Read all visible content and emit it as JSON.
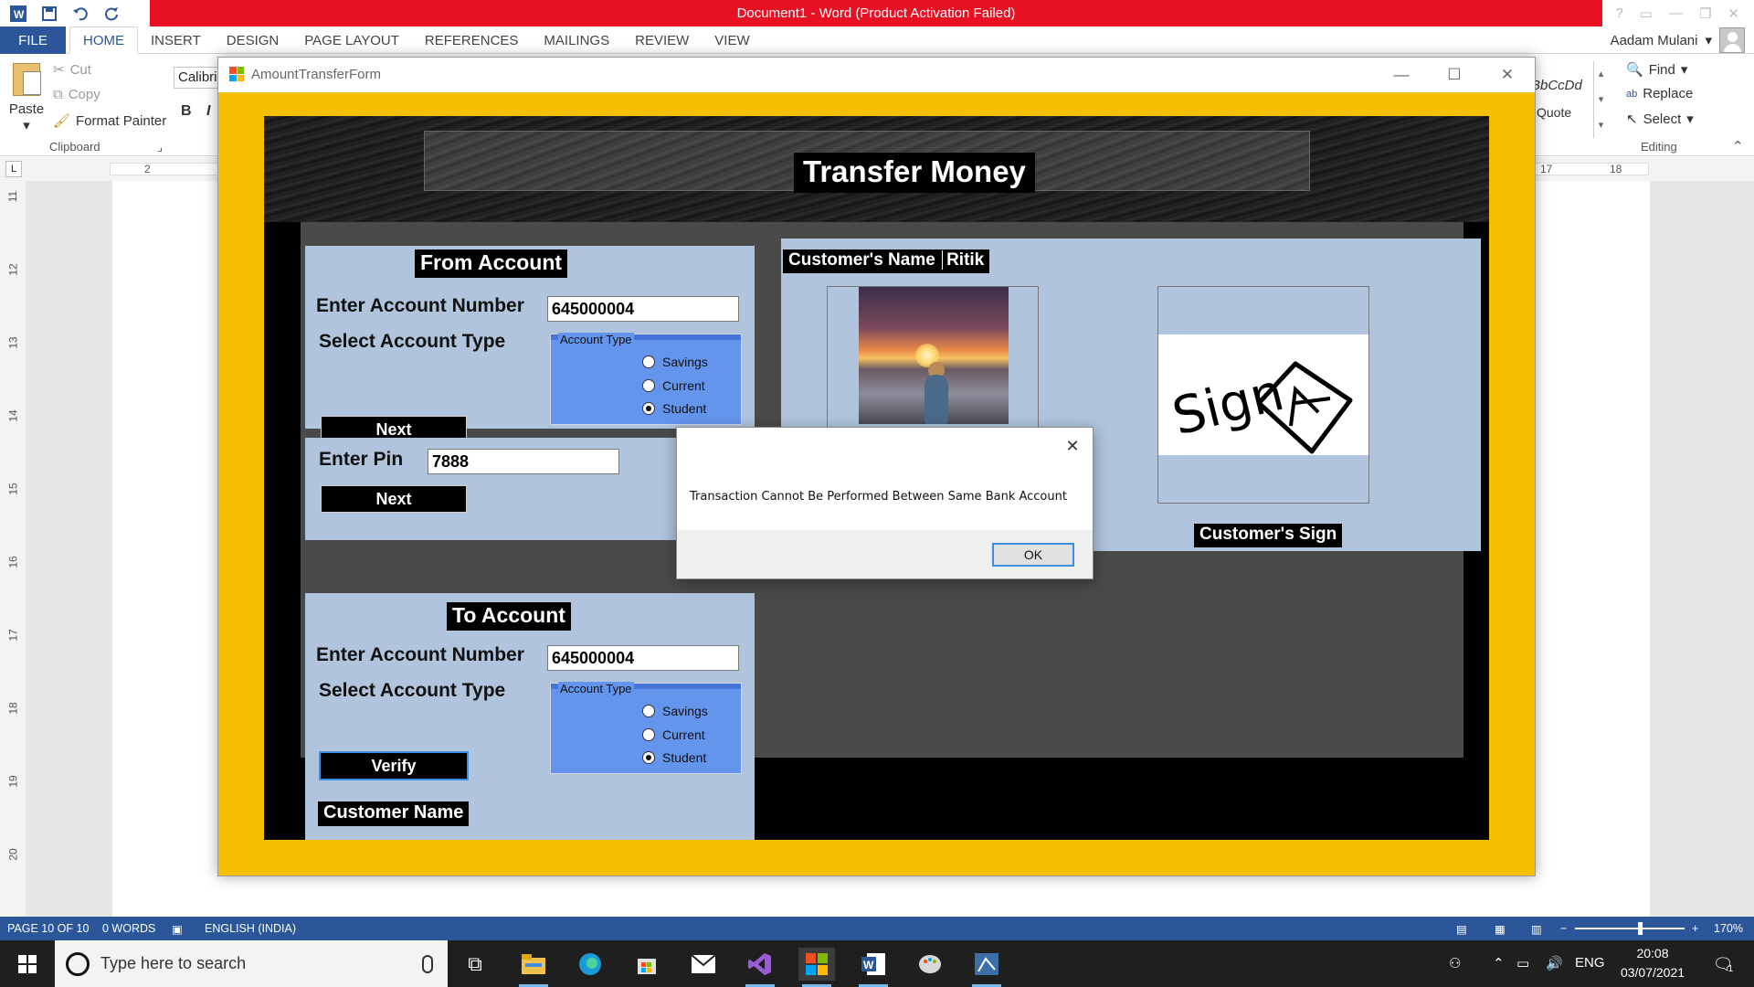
{
  "word": {
    "title": "Document1 - Word (Product Activation Failed)",
    "title_bar_color": "#e81123",
    "accent_color": "#2b579a",
    "title_right": {
      "help": "?"
    },
    "tabs": {
      "file": "FILE",
      "items": [
        "HOME",
        "INSERT",
        "DESIGN",
        "PAGE LAYOUT",
        "REFERENCES",
        "MAILINGS",
        "REVIEW",
        "VIEW"
      ],
      "active": "HOME"
    },
    "user": "Aadam Mulani",
    "clipboard": {
      "paste": "Paste",
      "cut": "Cut",
      "copy": "Copy",
      "format_painter": "Format Painter",
      "group": "Clipboard"
    },
    "font": {
      "name": "Calibri",
      "bold": "B",
      "italic": "I"
    },
    "styles": {
      "preview": "BbCcDd",
      "name": "Quote"
    },
    "editing": {
      "find": "Find",
      "replace": "Replace",
      "select": "Select",
      "group": "Editing"
    },
    "ruler": {
      "left": "2",
      "right_a": "17",
      "right_b": "18",
      "corner": "L"
    },
    "vruler": [
      "11",
      "12",
      "13",
      "14",
      "15",
      "16",
      "17",
      "18",
      "19",
      "20"
    ],
    "status": {
      "page": "PAGE 10 OF 10",
      "words": "0 WORDS",
      "language": "ENGLISH (INDIA)",
      "zoom": "170%"
    }
  },
  "taskbar": {
    "search_placeholder": "Type here to search",
    "tray": {
      "lang": "ENG",
      "time": "20:08",
      "date": "03/07/2021",
      "notif_count": "1"
    }
  },
  "form": {
    "title": "AmountTransferForm",
    "background_color": "#f6c000",
    "heading": "Transfer Money",
    "from_account": {
      "heading": "From Account",
      "account_label": "Enter Account Number",
      "account_value": "645000004",
      "type_label": "Select Account Type",
      "groupbox_title": "Account Type",
      "options": [
        "Savings",
        "Current",
        "Student"
      ],
      "selected": "Student",
      "next": "Next"
    },
    "pin": {
      "label": "Enter Pin",
      "value": "7888",
      "next": "Next"
    },
    "to_account": {
      "heading": "To Account",
      "account_label": "Enter Account Number",
      "account_value": "645000004",
      "type_label": "Select Account Type",
      "groupbox_title": "Account Type",
      "options": [
        "Savings",
        "Current",
        "Student"
      ],
      "selected": "Student",
      "verify": "Verify",
      "customer_name_label": "Customer Name"
    },
    "customer": {
      "name_label": "Customer's Name",
      "name_value": "Ritik",
      "sign_label": "Customer's Sign",
      "signature_text": "Sign"
    }
  },
  "message_box": {
    "text": "Transaction Cannot Be Performed Between Same Bank Account",
    "ok": "OK"
  }
}
